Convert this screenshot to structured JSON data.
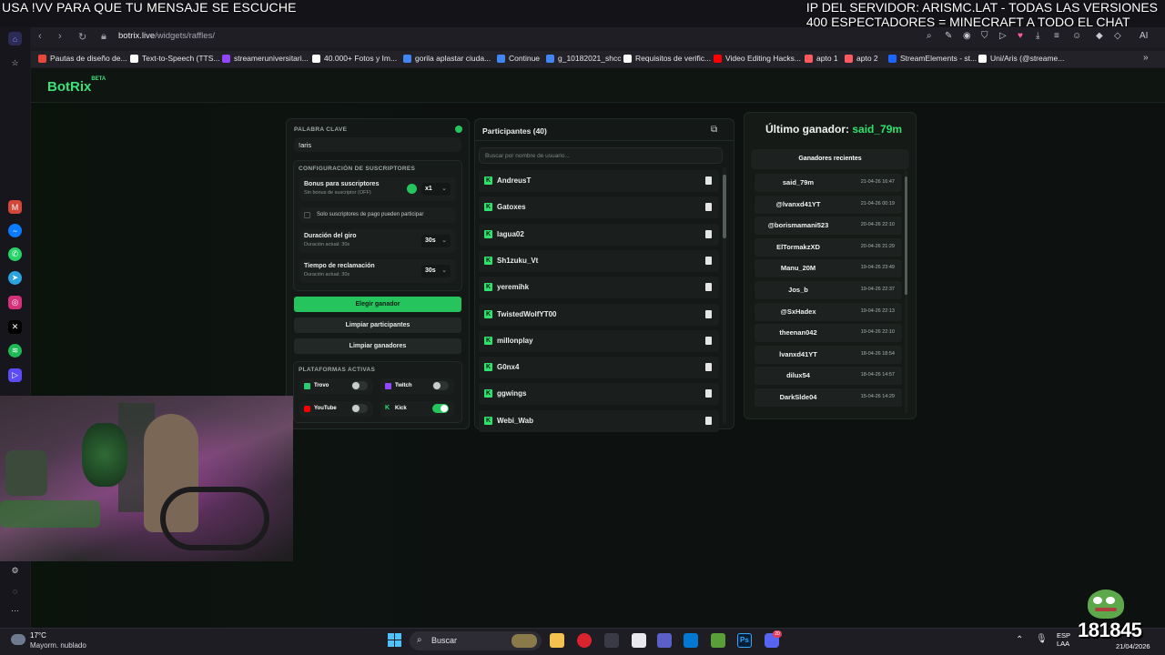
{
  "overlay": {
    "left_text": "USA !VV PARA QUE TU MENSAJE SE ESCUCHE",
    "right_line1": "IP DEL SERVIDOR: ARISMC.LAT - TODAS LAS VERSIONES",
    "right_line2": "400 ESPECTADORES = MINECRAFT A TODO EL CHAT"
  },
  "browser": {
    "url_domain": "botrix.live",
    "url_path": "/widgets/raffles/",
    "ai_label": "AI",
    "bookmarks": [
      {
        "label": "Pautas de diseño de...",
        "color": "#e8483b"
      },
      {
        "label": "Text-to-Speech (TTS...",
        "color": "#ffffff"
      },
      {
        "label": "streameruniversitari...",
        "color": "#9146ff"
      },
      {
        "label": "40.000+ Fotos y Im...",
        "color": "#ffffff"
      },
      {
        "label": "gorila aplastar ciuda...",
        "color": "#4285f4"
      },
      {
        "label": "Continue",
        "color": "#4285f4"
      },
      {
        "label": "g_10182021_shcc",
        "color": "#4285f4"
      },
      {
        "label": "Requisitos de verific...",
        "color": "#ffffff"
      },
      {
        "label": "Video Editing Hacks...",
        "color": "#ff0000"
      },
      {
        "label": "apto 1",
        "color": "#ff5a5f"
      },
      {
        "label": "apto 2",
        "color": "#ff5a5f"
      },
      {
        "label": "StreamElements - st...",
        "color": "#1b66ff"
      },
      {
        "label": "Uni/Aris (@streame...",
        "color": "#ffffff"
      }
    ]
  },
  "app": {
    "logo": "BotRix",
    "logo_badge": "BETA",
    "keyword_label": "PALABRA CLAVE",
    "keyword_value": "!aris",
    "subs_config_label": "CONFIGURACIÓN DE SUSCRIPTORES",
    "sub_bonus_title": "Bonus para suscriptores",
    "sub_bonus_sub": "Sin bonus de suscriptor (OFF)",
    "sub_bonus_value": "x1",
    "subs_only_label": "Solo suscriptores de pago pueden participar",
    "spin_title": "Duración del giro",
    "spin_sub": "Duración actual: 30s",
    "spin_value": "30s",
    "claim_title": "Tiempo de reclamación",
    "claim_sub": "Duración actual: 30s",
    "claim_value": "30s",
    "pick_winner": "Elegir ganador",
    "clear_participants": "Limpiar participantes",
    "clear_winners": "Limpiar ganadores",
    "platforms_label": "PLATAFORMAS ACTIVAS",
    "platforms": [
      {
        "name": "Trovo",
        "on": false
      },
      {
        "name": "Twitch",
        "on": false
      },
      {
        "name": "YouTube",
        "on": false
      },
      {
        "name": "Kick",
        "on": true
      }
    ],
    "participants_title": "Participantes (40)",
    "search_placeholder": "Buscar por nombre de usuario...",
    "participants": [
      "AndreusT",
      "Gatoxes",
      "lagua02",
      "Sh1zuku_Vt",
      "yeremihk",
      "TwistedWolfYT00",
      "millonplay",
      "G0nx4",
      "ggwings",
      "Webi_Wab"
    ],
    "last_winner_label": "Último ganador:",
    "last_winner": "said_79m",
    "recent_winners_label": "Ganadores recientes",
    "winners": [
      {
        "name": "said_79m",
        "date": "21-04-26 16:47"
      },
      {
        "name": "@lvanxd41YT",
        "date": "21-04-26 00:19"
      },
      {
        "name": "@borismamani523",
        "date": "20-04-26 22:10"
      },
      {
        "name": "ElTormakzXD",
        "date": "20-04-26 21:29"
      },
      {
        "name": "Manu_20M",
        "date": "19-04-26 23:49"
      },
      {
        "name": "Jos_b",
        "date": "19-04-26 22:37"
      },
      {
        "name": "@SxHadex",
        "date": "19-04-26 22:13"
      },
      {
        "name": "theenan042",
        "date": "19-04-26 22:10"
      },
      {
        "name": "lvanxd41YT",
        "date": "18-04-26 18:54"
      },
      {
        "name": "dilux54",
        "date": "18-04-26 14:57"
      },
      {
        "name": "DarkSlde04",
        "date": "15-04-26 14:29"
      }
    ]
  },
  "taskbar": {
    "weather_temp": "17°C",
    "weather_desc": "Mayorm. nublado",
    "search_label": "Buscar",
    "lang": "ESP",
    "lang_sub": "LAA",
    "date": "21/04/2026",
    "notif_count": "20",
    "viewer_count": "181845"
  }
}
